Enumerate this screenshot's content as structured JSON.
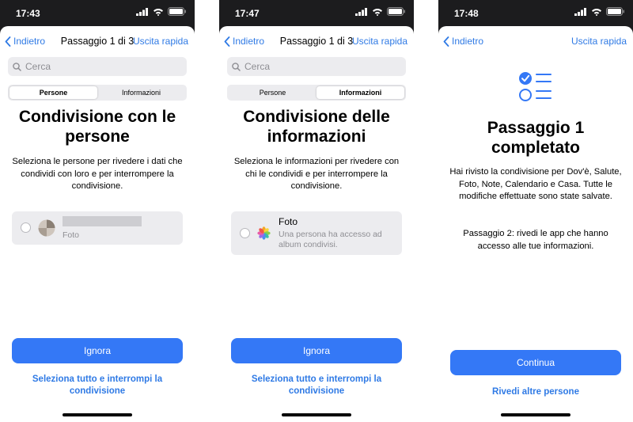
{
  "screens": [
    {
      "time": "17:43",
      "nav": {
        "back": "Indietro",
        "title": "Passaggio 1 di 3",
        "exit": "Uscita rapida"
      },
      "search": {
        "placeholder": "Cerca"
      },
      "tabs": [
        {
          "label": "Persone",
          "selected": true
        },
        {
          "label": "Informazioni",
          "selected": false
        }
      ],
      "heading": "Condivisione con le persone",
      "description": "Seleziona le persone per rivedere i dati che condividi con loro e per interrompere la condivisione.",
      "item": {
        "subtitle": "Foto"
      },
      "primary_button": "Ignora",
      "secondary_link": "Seleziona tutto e interrompi la condivisione"
    },
    {
      "time": "17:47",
      "nav": {
        "back": "Indietro",
        "title": "Passaggio 1 di 3",
        "exit": "Uscita rapida"
      },
      "search": {
        "placeholder": "Cerca"
      },
      "tabs": [
        {
          "label": "Persone",
          "selected": false
        },
        {
          "label": "Informazioni",
          "selected": true
        }
      ],
      "heading": "Condivisione delle informazioni",
      "description": "Seleziona le informazioni per rivedere con chi le condividi e per interrompere la condivisione.",
      "item": {
        "title": "Foto",
        "subtitle": "Una persona ha accesso ad album condivisi.",
        "icon": "photos-icon"
      },
      "primary_button": "Ignora",
      "secondary_link": "Seleziona tutto e interrompi la condivisione"
    },
    {
      "time": "17:48",
      "nav": {
        "back": "Indietro",
        "exit": "Uscita rapida"
      },
      "icon": "checklist-icon",
      "heading": "Passaggio 1 completato",
      "description": "Hai rivisto la condivisione per Dov'è, Salute, Foto, Note, Calendario e Casa. Tutte le modifiche effettuate sono state salvate.",
      "description2": "Passaggio 2: rivedi le app che hanno accesso alle tue informazioni.",
      "primary_button": "Continua",
      "secondary_link": "Rivedi altre persone"
    }
  ],
  "colors": {
    "accent": "#3478f6",
    "link": "#2f7ae5",
    "surface": "#ececef"
  }
}
